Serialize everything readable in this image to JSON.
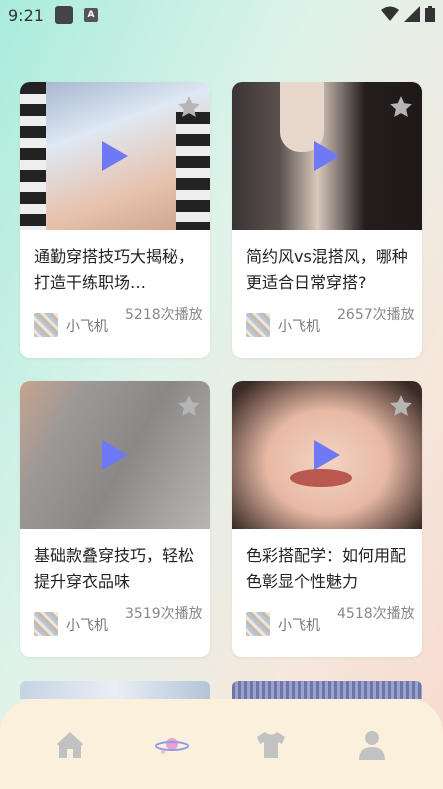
{
  "status_bar": {
    "time": "9:21",
    "notification_letter": "A"
  },
  "cards": [
    {
      "title": "通勤穿搭技巧大揭秘，打造干练职场…",
      "author": "小飞机",
      "plays": "5218次播放",
      "colors": [
        "#7d8fb1",
        "#dce6f2",
        "#e8c4b0"
      ]
    },
    {
      "title": "简约风vs混搭风，哪种更适合日常穿搭?",
      "author": "小飞机",
      "plays": "2657次播放",
      "colors": [
        "#2a2424",
        "#4a4040",
        "#d7c1b4"
      ]
    },
    {
      "title": "基础款叠穿技巧，轻松提升穿衣品味",
      "author": "小飞机",
      "plays": "3519次播放",
      "colors": [
        "#8f8d8b",
        "#aaa8a6",
        "#c9a793"
      ]
    },
    {
      "title": "色彩搭配学：如何用配色彰显个性魅力",
      "author": "小飞机",
      "plays": "4518次播放",
      "colors": [
        "#e9bba6",
        "#f2d2c2",
        "#caa08f"
      ]
    }
  ],
  "accent": "#6f78f5",
  "nav": {
    "items": [
      "home-icon",
      "planet-icon",
      "tshirt-icon",
      "user-icon"
    ],
    "active": 1
  }
}
